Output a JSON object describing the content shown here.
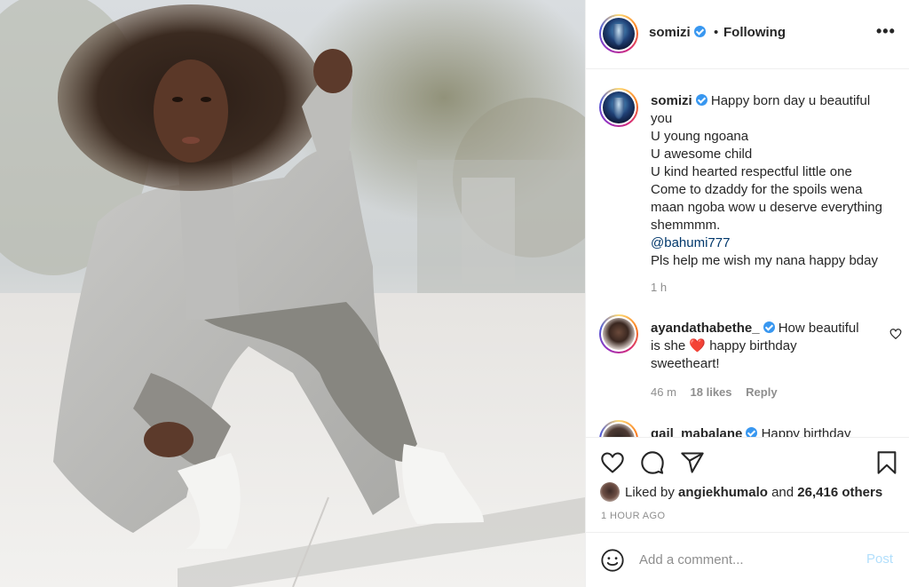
{
  "header": {
    "username": "somizi",
    "separator": "•",
    "follow_status": "Following",
    "more_label": "•••"
  },
  "caption": {
    "username": "somizi",
    "lines": [
      "Happy born day u beautiful",
      "you",
      "U young ngoana",
      "U awesome child",
      "U kind hearted respectful little one",
      "Come to dzaddy for the spoils wena",
      "maan ngoba wow u deserve everything",
      "shemmmm."
    ],
    "mention": "@bahumi777",
    "last_line": "Pls help me wish my nana happy bday",
    "time": "1 h"
  },
  "comments": [
    {
      "username": "ayandathabethe_",
      "text_before": "How beautiful",
      "text_mid": "is she",
      "emoji": "❤️",
      "text_after": "happy birthday",
      "text_end": "sweetheart!",
      "time": "46 m",
      "likes": "18 likes",
      "reply": "Reply"
    },
    {
      "username": "gail_mabalane",
      "text": "Happy birthday"
    }
  ],
  "actions": {
    "icons": [
      "heart-icon",
      "comment-icon",
      "share-icon",
      "bookmark-icon"
    ],
    "liked_by_prefix": "Liked by",
    "liked_by_user": "angiekhumalo",
    "liked_by_and": "and",
    "liked_by_others": "26,416 others",
    "time_ago": "1 HOUR AGO"
  },
  "add_comment": {
    "placeholder": "Add a comment...",
    "post_label": "Post"
  },
  "colors": {
    "verified": "#3897f0",
    "link": "#00376b",
    "muted": "#8e8e8e",
    "post_disabled": "#b2dffc",
    "heart_emoji": "#ed4956"
  }
}
